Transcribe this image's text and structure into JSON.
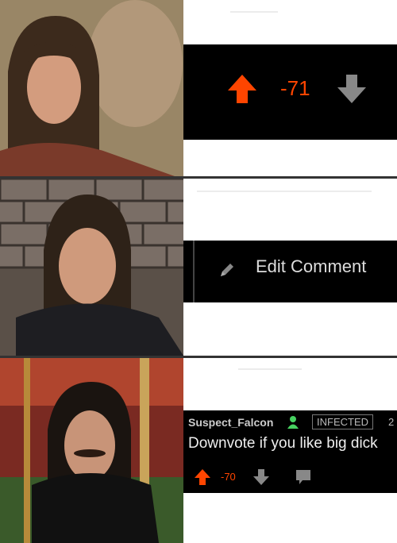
{
  "colors": {
    "upvote": "#ff4500",
    "icon_gray": "#888888",
    "bar_bg": "#000000"
  },
  "panel1": {
    "score": "-71",
    "icons": [
      "upvote-arrow-icon",
      "downvote-arrow-icon"
    ]
  },
  "panel2": {
    "edit_label": "Edit Comment",
    "icons": [
      "pencil-icon"
    ]
  },
  "panel3": {
    "username": "Suspect_Falcon",
    "flair": "INFECTED",
    "time_partial": "2",
    "body": "Downvote if you like big dick",
    "score": "-70",
    "icons": [
      "user-icon",
      "upvote-arrow-icon",
      "downvote-arrow-icon",
      "reply-icon"
    ]
  }
}
